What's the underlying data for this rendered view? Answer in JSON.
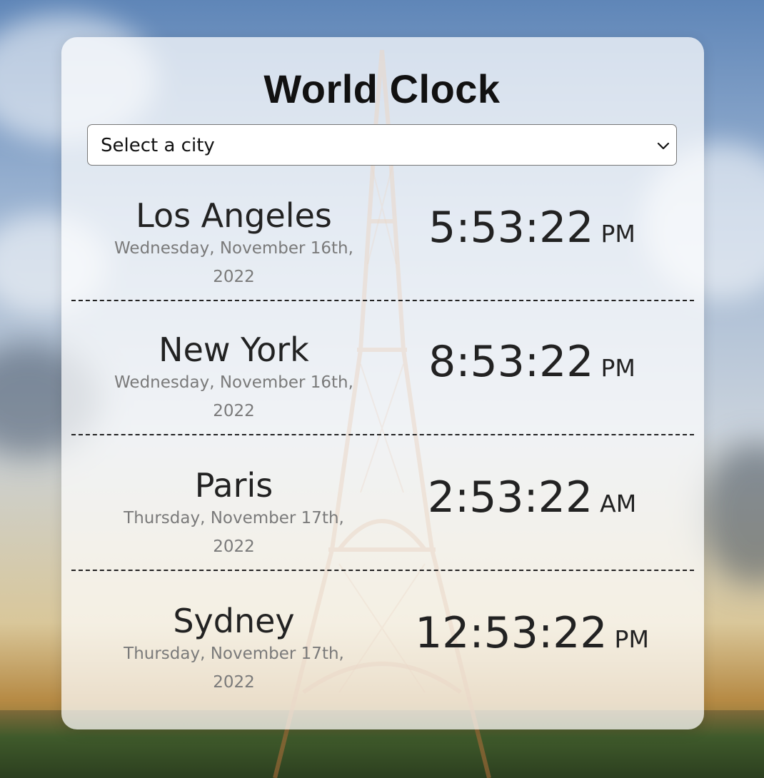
{
  "app": {
    "title": "World Clock"
  },
  "city_select": {
    "selected": "Select a city",
    "icon": "chevron-down-icon"
  },
  "cities": [
    {
      "name": "Los Angeles",
      "date": "Wednesday, November 16th, 2022",
      "time": "5:53:22",
      "ampm": "PM"
    },
    {
      "name": "New York",
      "date": "Wednesday, November 16th, 2022",
      "time": "8:53:22",
      "ampm": "PM"
    },
    {
      "name": "Paris",
      "date": "Thursday, November 17th, 2022",
      "time": "2:53:22",
      "ampm": "AM"
    },
    {
      "name": "Sydney",
      "date": "Thursday, November 17th, 2022",
      "time": "12:53:22",
      "ampm": "PM"
    }
  ],
  "colors": {
    "card_bg": "#ffffffb8",
    "text": "#222222",
    "date_text": "#7a7a7a",
    "divider": "#222222"
  }
}
